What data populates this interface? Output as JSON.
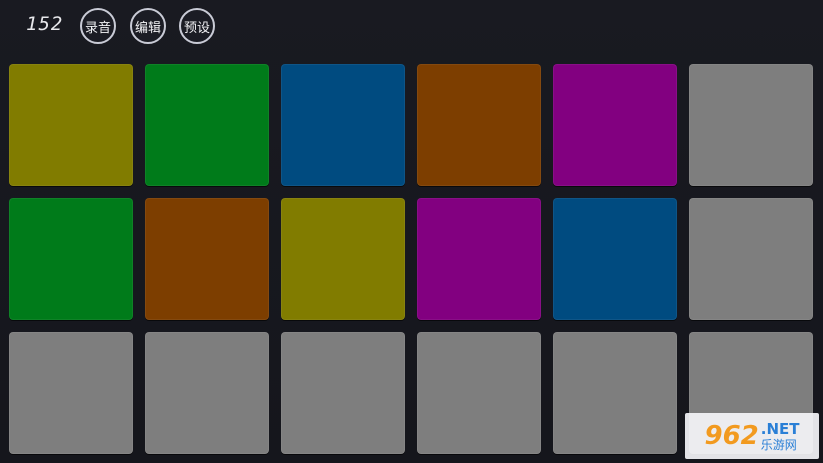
{
  "toolbar": {
    "bpm": "152",
    "record_label": "录音",
    "edit_label": "编辑",
    "preset_label": "预设"
  },
  "colors": {
    "olive": "#817c00",
    "green": "#007b1a",
    "blue": "#004b80",
    "brown": "#7d3e00",
    "purple": "#820080",
    "gray": "#7e7e7e"
  },
  "pads": [
    [
      "olive",
      "green",
      "blue",
      "brown",
      "purple",
      "gray"
    ],
    [
      "green",
      "brown",
      "olive",
      "purple",
      "blue",
      "gray"
    ],
    [
      "gray",
      "gray",
      "gray",
      "gray",
      "gray",
      "gray"
    ]
  ],
  "watermark": {
    "logo": "962",
    "net": ".NET",
    "cn": "乐游网"
  }
}
